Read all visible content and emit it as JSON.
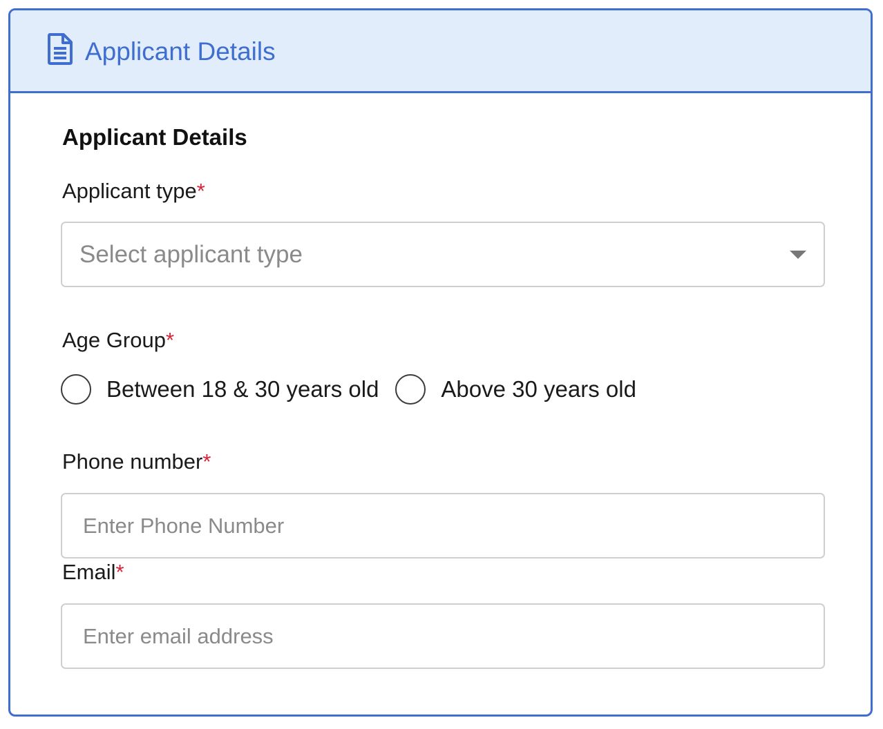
{
  "header": {
    "icon": "document-icon",
    "title": "Applicant Details"
  },
  "section": {
    "title": "Applicant Details"
  },
  "applicant_type": {
    "label": "Applicant type",
    "required_mark": "*",
    "placeholder": "Select applicant type"
  },
  "age_group": {
    "label": "Age Group",
    "required_mark": "*",
    "options": [
      {
        "label": "Between 18 & 30 years old"
      },
      {
        "label": "Above 30 years old"
      }
    ]
  },
  "phone": {
    "label": "Phone number",
    "required_mark": "*",
    "placeholder": "Enter Phone Number"
  },
  "email": {
    "label": "Email",
    "required_mark": "*",
    "placeholder": "Enter email address"
  },
  "colors": {
    "accent": "#3f6ed0",
    "header_bg": "#e1edfa",
    "required": "#d6243a"
  }
}
